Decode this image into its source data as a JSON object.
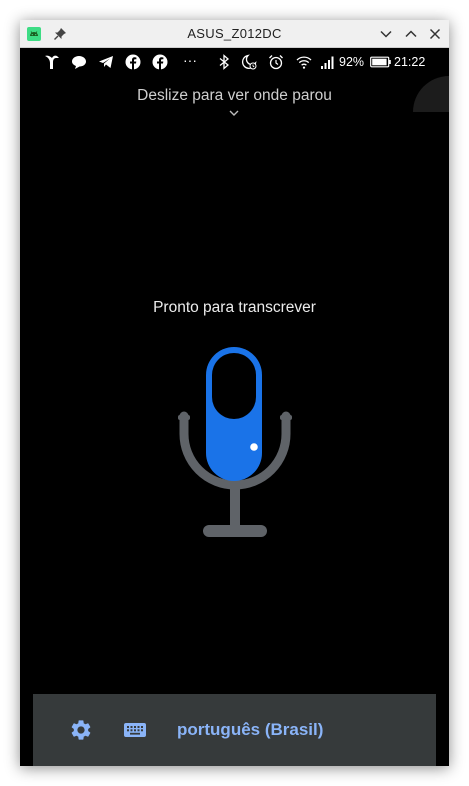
{
  "window": {
    "title": "ASUS_Z012DC",
    "app_icon": "android-icon",
    "pin_icon": "pin-icon",
    "controls": [
      "minimize-icon",
      "maximize-icon",
      "close-icon"
    ]
  },
  "status_bar": {
    "notification_icons": [
      "bird-app-icon",
      "chat-bubble-icon",
      "telegram-icon",
      "facebook-icon",
      "facebook-icon",
      "more-dots-icon"
    ],
    "more_dots": "···",
    "system_icons": [
      "bluetooth-icon",
      "do-not-disturb-icon",
      "alarm-icon",
      "wifi-icon",
      "signal-icon"
    ],
    "battery": "92%",
    "time": "21:22"
  },
  "main": {
    "swipe_hint": "Deslize para ver onde parou",
    "status_message": "Pronto para transcrever",
    "accent_color": "#1a73e8",
    "mic_stand_color": "#5f6368"
  },
  "bottom_bar": {
    "settings_icon": "gear-icon",
    "keyboard_icon": "keyboard-icon",
    "language": "português (Brasil)",
    "accent_color": "#8ab4f8"
  }
}
